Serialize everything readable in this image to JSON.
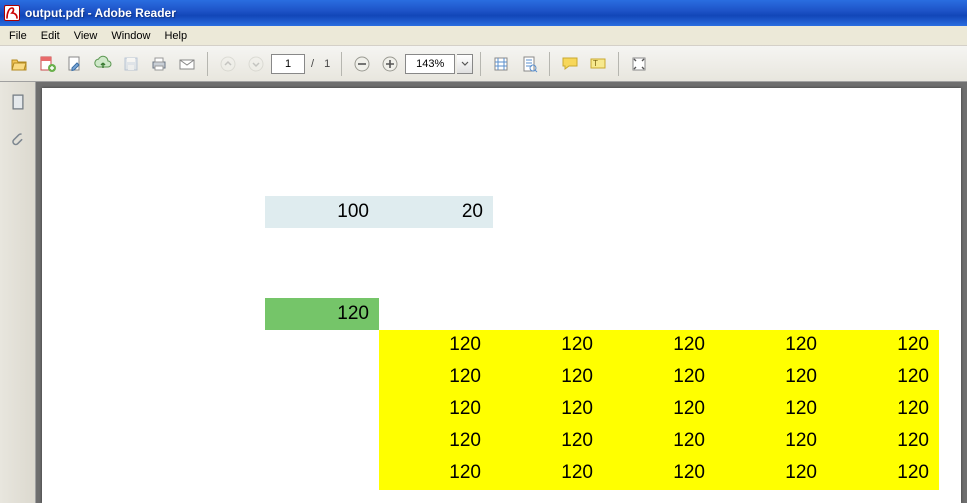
{
  "window": {
    "title": "output.pdf - Adobe Reader"
  },
  "menu": {
    "file": "File",
    "edit": "Edit",
    "view": "View",
    "window": "Window",
    "help": "Help"
  },
  "toolbar": {
    "page_current": "1",
    "page_sep": "/",
    "page_total": "1",
    "zoom": "143%"
  },
  "doc": {
    "blue_a": "100",
    "blue_b": "20",
    "green_a": "120",
    "yellow_rows": [
      [
        "120",
        "120",
        "120",
        "120",
        "120"
      ],
      [
        "120",
        "120",
        "120",
        "120",
        "120"
      ],
      [
        "120",
        "120",
        "120",
        "120",
        "120"
      ],
      [
        "120",
        "120",
        "120",
        "120",
        "120"
      ],
      [
        "120",
        "120",
        "120",
        "120",
        "120"
      ]
    ]
  }
}
